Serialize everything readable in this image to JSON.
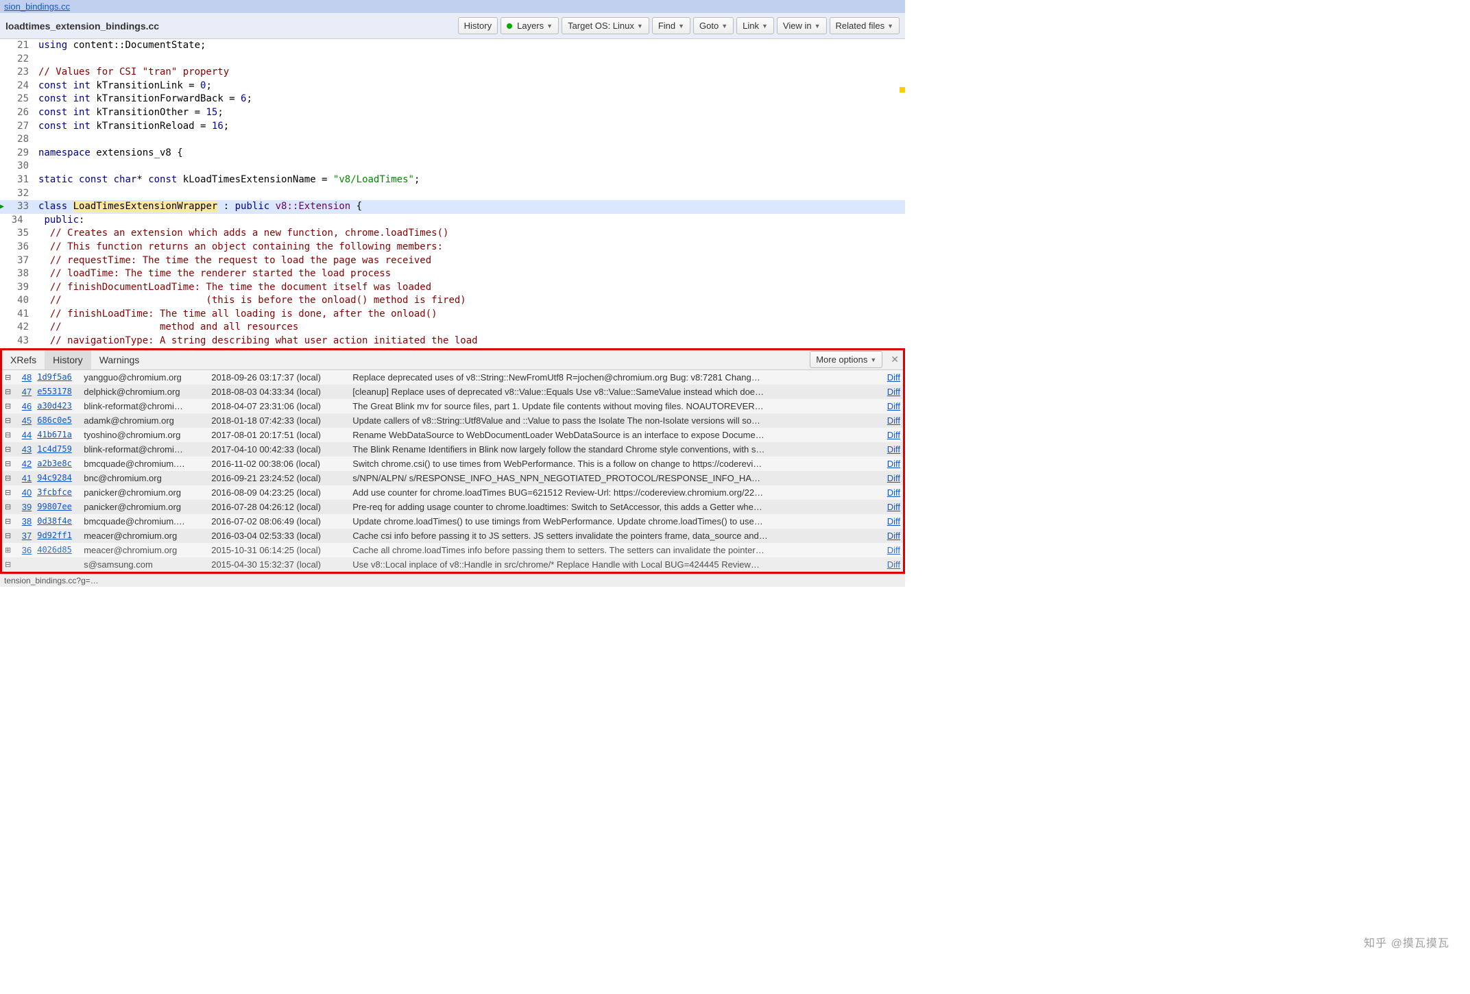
{
  "breadcrumb": {
    "link": "sion_bindings.cc"
  },
  "header": {
    "title": "loadtimes_extension_bindings.cc",
    "buttons": {
      "history": "History",
      "layers": "Layers",
      "target_os": "Target OS: Linux",
      "find": "Find",
      "goto": "Goto",
      "link": "Link",
      "view_in": "View in",
      "related_files": "Related files"
    }
  },
  "code": {
    "lines": [
      {
        "n": 21,
        "html": "<span class='kw'>using</span> content::DocumentState;"
      },
      {
        "n": 22,
        "html": ""
      },
      {
        "n": 23,
        "html": "<span class='cm'>// Values for CSI \"tran\" property</span>"
      },
      {
        "n": 24,
        "html": "<span class='kw'>const</span> <span class='kw'>int</span> kTransitionLink = <span class='num'>0</span>;"
      },
      {
        "n": 25,
        "html": "<span class='kw'>const</span> <span class='kw'>int</span> kTransitionForwardBack = <span class='num'>6</span>;"
      },
      {
        "n": 26,
        "html": "<span class='kw'>const</span> <span class='kw'>int</span> kTransitionOther = <span class='num'>15</span>;"
      },
      {
        "n": 27,
        "html": "<span class='kw'>const</span> <span class='kw'>int</span> kTransitionReload = <span class='num'>16</span>;"
      },
      {
        "n": 28,
        "html": ""
      },
      {
        "n": 29,
        "html": "<span class='kw'>namespace</span> extensions_v8 {"
      },
      {
        "n": 30,
        "html": ""
      },
      {
        "n": 31,
        "html": "<span class='kw'>static</span> <span class='kw'>const</span> <span class='kw'>char</span>* <span class='kw'>const</span> kLoadTimesExtensionName = <span class='str'>\"v8/LoadTimes\"</span>;"
      },
      {
        "n": 32,
        "html": ""
      },
      {
        "n": 33,
        "hl": true,
        "arrow": true,
        "html": "<span class='kw'>class</span> <span class='cls-name'>LoadTimesExtensionWrapper</span> : <span class='kw'>public</span> <span class='ty'>v8::Extension</span> {"
      },
      {
        "n": 34,
        "fold": true,
        "html": " <span class='kw'>public</span>:"
      },
      {
        "n": 35,
        "html": "  <span class='cm'>// Creates an extension which adds a new function, chrome.loadTimes()</span>"
      },
      {
        "n": 36,
        "html": "  <span class='cm'>// This function returns an object containing the following members:</span>"
      },
      {
        "n": 37,
        "html": "  <span class='cm'>// requestTime: The time the request to load the page was received</span>"
      },
      {
        "n": 38,
        "html": "  <span class='cm'>// loadTime: The time the renderer started the load process</span>"
      },
      {
        "n": 39,
        "html": "  <span class='cm'>// finishDocumentLoadTime: The time the document itself was loaded</span>"
      },
      {
        "n": 40,
        "html": "  <span class='cm'>//                         (this is before the onload() method is fired)</span>"
      },
      {
        "n": 41,
        "html": "  <span class='cm'>// finishLoadTime: The time all loading is done, after the onload()</span>"
      },
      {
        "n": 42,
        "html": "  <span class='cm'>//                 method and all resources</span>"
      },
      {
        "n": 43,
        "html": "  <span class='cm'>// navigationType: A string describing what user action initiated the load</span>"
      }
    ]
  },
  "bottom": {
    "tabs": {
      "xrefs": "XRefs",
      "history": "History",
      "warnings": "Warnings"
    },
    "more": "More options",
    "rows": [
      {
        "i": "48",
        "h": "1d9f5a6",
        "a": "yangguo@chromium.org",
        "d": "2018-09-26 03:17:37 (local)",
        "m": "Replace deprecated uses of v8::String::NewFromUtf8 R=jochen@chromium.org Bug: v8:7281 Chang…"
      },
      {
        "i": "47",
        "h": "e553178",
        "a": "delphick@chromium.org",
        "d": "2018-08-03 04:33:34 (local)",
        "m": "[cleanup] Replace uses of deprecated v8::Value::Equals Use v8::Value::SameValue instead which doe…"
      },
      {
        "i": "46",
        "h": "a30d423",
        "a": "blink-reformat@chromi…",
        "d": "2018-04-07 23:31:06 (local)",
        "m": "The Great Blink mv for source files, part 1. Update file contents without moving files. NOAUTOREVER…"
      },
      {
        "i": "45",
        "h": "686c0e5",
        "a": "adamk@chromium.org",
        "d": "2018-01-18 07:42:33 (local)",
        "m": "Update callers of v8::String::Utf8Value and ::Value to pass the Isolate The non-Isolate versions will so…"
      },
      {
        "i": "44",
        "h": "41b671a",
        "a": "tyoshino@chromium.org",
        "d": "2017-08-01 20:17:51 (local)",
        "m": "Rename WebDataSource to WebDocumentLoader WebDataSource is an interface to expose Docume…"
      },
      {
        "i": "43",
        "h": "1c4d759",
        "a": "blink-reformat@chromi…",
        "d": "2017-04-10 00:42:33 (local)",
        "m": "The Blink Rename Identifiers in Blink now largely follow the standard Chrome style conventions, with s…"
      },
      {
        "i": "42",
        "h": "a2b3e8c",
        "a": "bmcquade@chromium.…",
        "d": "2016-11-02 00:38:06 (local)",
        "m": "Switch chrome.csi() to use times from WebPerformance. This is a follow on change to https://coderevi…"
      },
      {
        "i": "41",
        "h": "94c9284",
        "a": "bnc@chromium.org",
        "d": "2016-09-21 23:24:52 (local)",
        "m": "s/NPN/ALPN/ s/RESPONSE_INFO_HAS_NPN_NEGOTIATED_PROTOCOL/RESPONSE_INFO_HA…"
      },
      {
        "i": "40",
        "h": "3fcbfce",
        "a": "panicker@chromium.org",
        "d": "2016-08-09 04:23:25 (local)",
        "m": "Add use counter for chrome.loadTimes BUG=621512 Review-Url: https://codereview.chromium.org/22…"
      },
      {
        "i": "39",
        "h": "99807ee",
        "a": "panicker@chromium.org",
        "d": "2016-07-28 04:26:12 (local)",
        "m": "Pre-req for adding usage counter to chrome.loadtimes: Switch to SetAccessor, this adds a Getter whe…"
      },
      {
        "i": "38",
        "h": "0d38f4e",
        "a": "bmcquade@chromium.…",
        "d": "2016-07-02 08:06:49 (local)",
        "m": "Update chrome.loadTimes() to use timings from WebPerformance. Update chrome.loadTimes() to use…"
      },
      {
        "i": "37",
        "h": "9d92ff1",
        "a": "meacer@chromium.org",
        "d": "2016-03-04 02:53:33 (local)",
        "m": "Cache csi info before passing it to JS setters. JS setters invalidate the pointers frame, data_source and…"
      }
    ],
    "faded_rows": [
      {
        "i": "36",
        "h": "4026d85",
        "a": "meacer@chromium.org",
        "d": "2015-10-31 06:14:25 (local)",
        "m": "Cache all chrome.loadTimes info before passing them to setters. The setters can invalidate the pointer…"
      },
      {
        "i": "",
        "h": "",
        "a": "s@samsung.com",
        "d": "2015-04-30 15:32:37 (local)",
        "m": "Use v8::Local inplace of v8::Handle in src/chrome/* Replace Handle with Local BUG=424445 Review…"
      }
    ],
    "diff_label": "Diff"
  },
  "status": "tension_bindings.cc?g=…",
  "watermark": "知乎 @摸瓦摸瓦"
}
